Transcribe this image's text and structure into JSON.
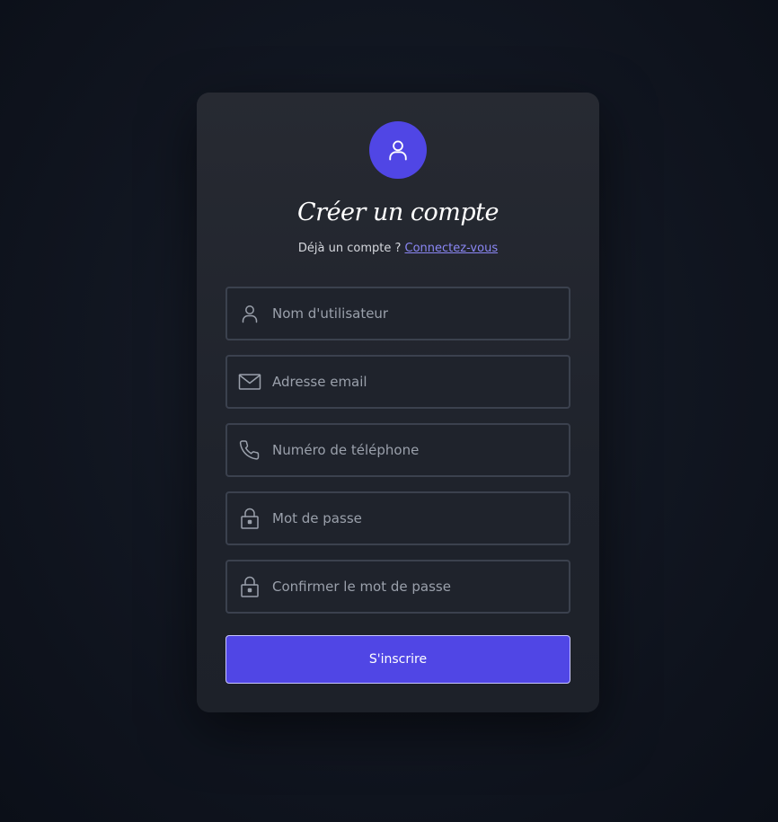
{
  "header": {
    "avatar_icon": "user-icon",
    "title": "Créer un compte",
    "subtitle_prefix": "Déjà un compte ?",
    "login_link": "Connectez-vous"
  },
  "form": {
    "fields": [
      {
        "icon": "user-icon",
        "placeholder": "Nom d'utilisateur",
        "value": ""
      },
      {
        "icon": "mail-icon",
        "placeholder": "Adresse email",
        "value": ""
      },
      {
        "icon": "phone-icon",
        "placeholder": "Numéro de téléphone",
        "value": ""
      },
      {
        "icon": "lock-icon",
        "placeholder": "Mot de passe",
        "value": ""
      },
      {
        "icon": "lock-icon",
        "placeholder": "Confirmer le mot de passe",
        "value": ""
      }
    ],
    "submit_label": "S'inscrire"
  },
  "colors": {
    "accent": "#5046e5",
    "link": "#8b87f5",
    "card_bg": "#23272f",
    "field_border": "#3b414e"
  }
}
